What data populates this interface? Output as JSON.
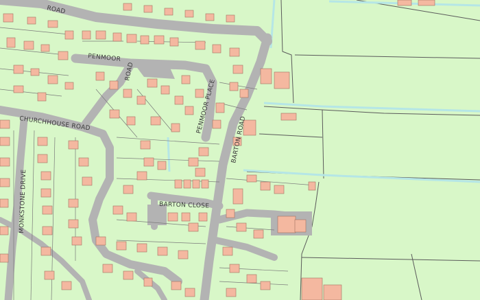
{
  "map": {
    "background_color": "#d8f7c8",
    "road_color": "#b3b3b3",
    "building_color": "#f4b8a0",
    "water_color": "#c8ecec",
    "boundary_color": "#5a5a5a"
  },
  "labels": {
    "road_top": "ROAD",
    "penmoor": "PENMOOR",
    "penmoor_road": "ROAD",
    "church_house_road": "CHURCHHOUSE ROAD",
    "monkstone_drive": "MONKSTONE DRIVE",
    "penmoor_place": "PENMOOR PLACE",
    "barton_road": "BARTON ROAD",
    "barton_close": "BARTON CLOSE"
  }
}
